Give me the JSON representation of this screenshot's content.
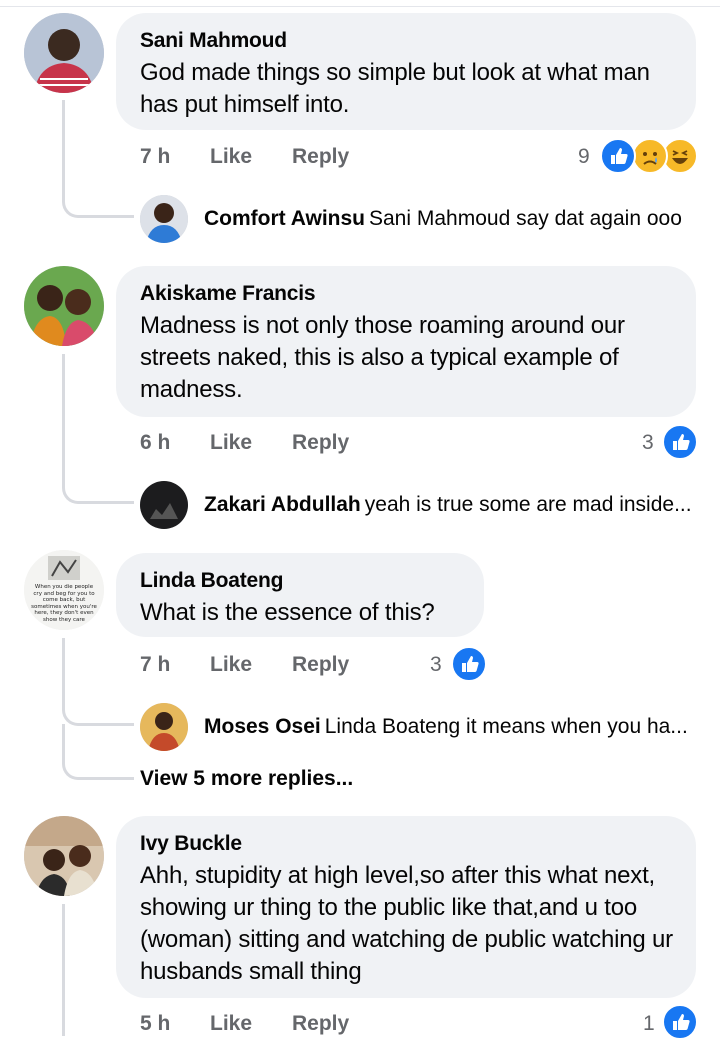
{
  "comments": [
    {
      "name": "Sani Mahmoud",
      "text": "God made things so simple but look at what man has put himself into.",
      "time": "7 h",
      "like_label": "Like",
      "reply_label": "Reply",
      "reaction_count": "9",
      "reactions": [
        "like-icon",
        "sad-icon",
        "haha-icon"
      ],
      "replies": [
        {
          "name": "Comfort Awinsu",
          "text": "Sani Mahmoud say dat again ooo"
        }
      ]
    },
    {
      "name": "Akiskame Francis",
      "text": "Madness is not only those roaming around our streets naked, this is also a typical example of madness.",
      "time": "6 h",
      "like_label": "Like",
      "reply_label": "Reply",
      "reaction_count": "3",
      "reactions": [
        "like-icon"
      ],
      "replies": [
        {
          "name": "Zakari Abdullah",
          "text": "yeah is true some are mad inside..."
        }
      ]
    },
    {
      "name": "Linda Boateng",
      "text": "What is the essence of this?",
      "time": "7 h",
      "like_label": "Like",
      "reply_label": "Reply",
      "reaction_count": "3",
      "reactions": [
        "like-icon"
      ],
      "avatar_caption": "When you die people cry and beg for you to come back, but sometimes when you're here, they don't even show they care",
      "replies": [
        {
          "name": "Moses Osei",
          "text": "Linda Boateng it means when you ha..."
        }
      ],
      "view_more": "View 5 more replies..."
    },
    {
      "name": "Ivy Buckle",
      "text": "Ahh, stupidity at high level,so after this what next, showing ur thing to the public like that,and u too (woman) sitting and watching de public watching ur husbands small thing",
      "time": "5 h",
      "like_label": "Like",
      "reply_label": "Reply",
      "reaction_count": "1",
      "reactions": [
        "like-icon"
      ]
    }
  ],
  "colors": {
    "bubble": "#f0f2f5",
    "meta": "#65676b",
    "like_blue": "#1877f2",
    "emoji_yellow": "#f7b928",
    "thread": "#d8dadf"
  }
}
